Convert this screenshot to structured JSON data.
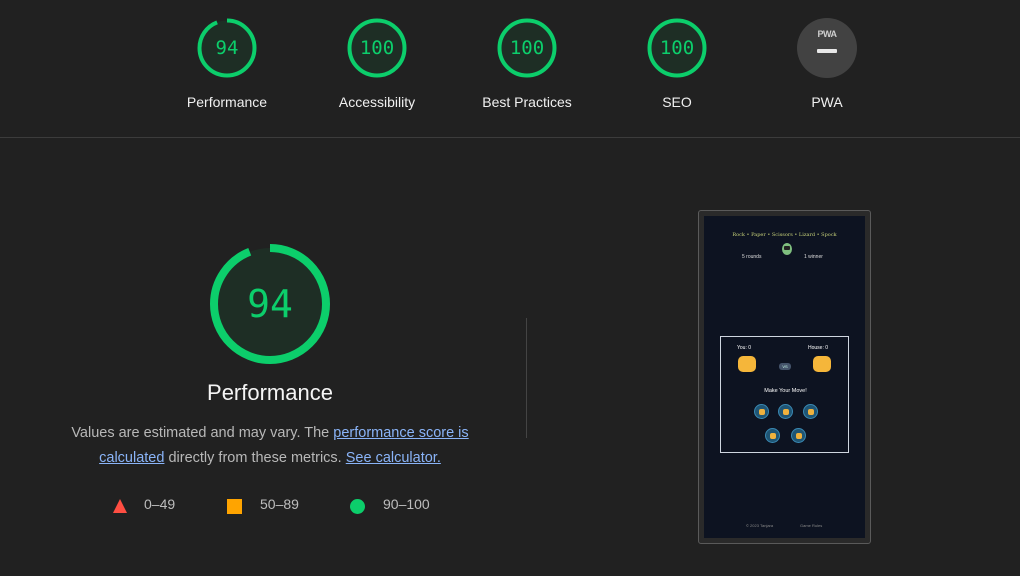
{
  "summary": [
    {
      "score": "94",
      "label": "Performance"
    },
    {
      "score": "100",
      "label": "Accessibility"
    },
    {
      "score": "100",
      "label": "Best Practices"
    },
    {
      "score": "100",
      "label": "SEO"
    }
  ],
  "pwa": {
    "badge_text": "PWA",
    "label": "PWA"
  },
  "performance": {
    "score": "94",
    "title": "Performance",
    "desc_prefix": "Values are estimated and may vary. The ",
    "desc_link": "performance score is calculated",
    "desc_middle": " directly from these metrics. ",
    "desc_link2": "See calculator."
  },
  "legend": {
    "poor": "0–49",
    "average": "50–89",
    "good": "90–100"
  },
  "colors": {
    "good": "#0cce6b",
    "average": "#ffa400",
    "poor": "#ff4e42"
  },
  "thumbnail": {
    "title": "Rock • Paper • Scissors • Lizard • Spock",
    "rounds": "5 rounds",
    "winner": "1 winner",
    "you": "You: 0",
    "house": "House: 0",
    "vs": "VS",
    "make_move": "Make Your Move!",
    "footer_left": "© 2023 Tanjara",
    "footer_right": "Game Rules"
  }
}
